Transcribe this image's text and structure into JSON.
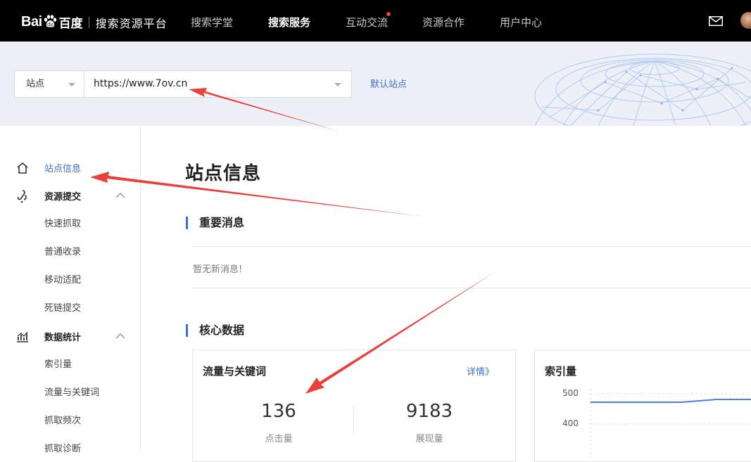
{
  "header": {
    "logo_text": "Bai",
    "logo_cn": "百度",
    "platform": "搜索资源平台",
    "nav": [
      "搜索学堂",
      "搜索服务",
      "互动交流",
      "资源合作",
      "用户中心"
    ],
    "active_nav": "搜索服务",
    "icons": [
      "mail-icon",
      "avatar"
    ]
  },
  "site_bar": {
    "select_label": "站点",
    "url_value": "https://www.7ov.cn",
    "default_site_link": "默认站点"
  },
  "sidebar": {
    "items": [
      {
        "label": "站点信息",
        "icon": "home-icon",
        "active": true
      },
      {
        "label": "资源提交",
        "icon": "submit-icon",
        "expanded": true,
        "children": [
          "快速抓取",
          "普通收录",
          "移动适配",
          "死链提交"
        ]
      },
      {
        "label": "数据统计",
        "icon": "stats-icon",
        "expanded": true,
        "children": [
          "索引量",
          "流量与关键词",
          "抓取频次",
          "抓取诊断"
        ]
      }
    ]
  },
  "main": {
    "title": "站点信息",
    "important_news": {
      "title": "重要消息",
      "empty_text": "暂无新消息!"
    },
    "core_data": {
      "title": "核心数据",
      "traffic_card": {
        "title": "流量与关键词",
        "link": "详情》",
        "metrics": [
          {
            "value": "136",
            "label": "点击量"
          },
          {
            "value": "9183",
            "label": "展现量"
          }
        ]
      },
      "index_card": {
        "title": "索引量",
        "y_ticks": [
          "500",
          "400"
        ]
      }
    }
  },
  "colors": {
    "accent": "#3b6fd1",
    "topbar": "#000000",
    "banner": "#edf0f7",
    "annotation_arrow": "#e8403a"
  }
}
